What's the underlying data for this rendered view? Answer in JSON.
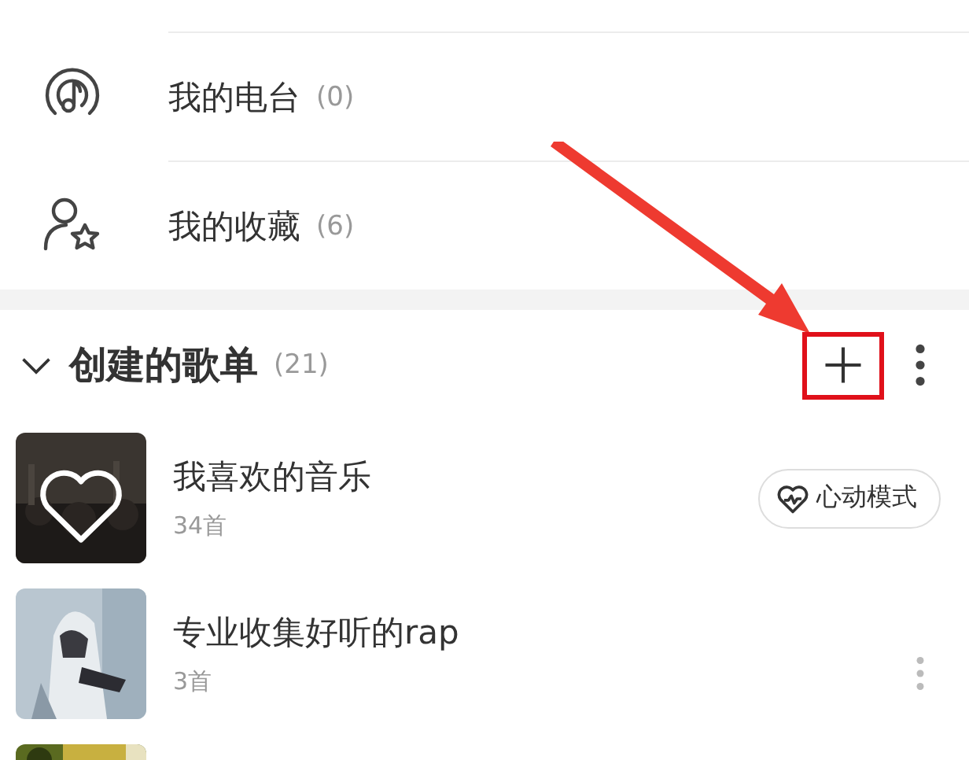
{
  "menu_items": [
    {
      "kind": "radio",
      "label": "我的电台",
      "count": "(0)"
    },
    {
      "kind": "favorites",
      "label": "我的收藏",
      "count": "(6)"
    }
  ],
  "section": {
    "title": "创建的歌单",
    "count": "(21)",
    "expanded": true,
    "highlighted_add": true
  },
  "playlists": [
    {
      "kind": "liked",
      "name": "我喜欢的音乐",
      "tracks": "34首",
      "action": "心动模式"
    },
    {
      "kind": "normal",
      "name": "专业收集好听的rap",
      "tracks": "3首"
    },
    {
      "kind": "partial"
    }
  ]
}
